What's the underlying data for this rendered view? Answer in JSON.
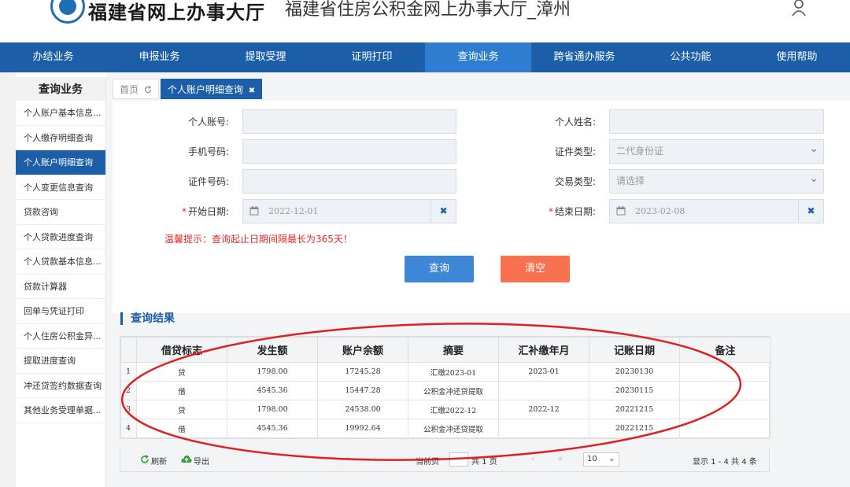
{
  "header": {
    "brand": "福建省网上办事大厅",
    "site_title": "福建省住房公积金网上办事大厅_漳州"
  },
  "nav": [
    "办结业务",
    "申报业务",
    "提取受理",
    "证明打印",
    "查询业务",
    "跨省通办服务",
    "公共功能",
    "使用帮助"
  ],
  "nav_active": "查询业务",
  "sidebar": {
    "title": "查询业务",
    "items": [
      "个人账户基本信息...",
      "个人缴存明细查询",
      "个人账户明细查询",
      "个人变更信息查询",
      "贷款咨询",
      "个人贷款进度查询",
      "个人贷款基本信息...",
      "贷款计算器",
      "回单与凭证打印",
      "个人住房公积金异...",
      "提取进度查询",
      "冲还贷签约数据查询",
      "其他业务受理单据..."
    ],
    "active": "个人账户明细查询"
  },
  "tabs": {
    "home": "首页",
    "active": "个人账户明细查询"
  },
  "form": {
    "account_label": "个人账号:",
    "name_label": "个人姓名:",
    "phone_label": "手机号码:",
    "id_type_label": "证件类型:",
    "id_type_value": "二代身份证",
    "id_no_label": "证件号码:",
    "trade_type_label": "交易类型:",
    "trade_type_placeholder": "请选择",
    "start_label": "开始日期:",
    "start_value": "2022-12-01",
    "end_label": "结束日期:",
    "end_value": "2023-02-08",
    "required_mark": "*",
    "clear_x": "✖",
    "tip": "温馨提示：查询起止日期间隔最长为365天！",
    "query_btn": "查询",
    "clear_btn": "清空"
  },
  "result": {
    "title": "查询结果",
    "columns": [
      "借贷标志",
      "发生额",
      "账户余额",
      "摘要",
      "汇补缴年月",
      "记账日期",
      "备注"
    ],
    "rows": [
      {
        "idx": "1",
        "flag": "贷",
        "amount": "1798.00",
        "balance": "17245.28",
        "summary": "汇缴2023-01",
        "ym": "2023-01",
        "date": "20230130",
        "remark": ""
      },
      {
        "idx": "2",
        "flag": "借",
        "amount": "4545.36",
        "balance": "15447.28",
        "summary": "公积金冲还贷提取",
        "ym": "",
        "date": "20230115",
        "remark": ""
      },
      {
        "idx": "3",
        "flag": "贷",
        "amount": "1798.00",
        "balance": "24538.00",
        "summary": "汇缴2022-12",
        "ym": "2022-12",
        "date": "20221215",
        "remark": ""
      },
      {
        "idx": "4",
        "flag": "借",
        "amount": "4545.36",
        "balance": "19992.64",
        "summary": "公积金冲还贷提取",
        "ym": "",
        "date": "20221215",
        "remark": ""
      }
    ]
  },
  "pager": {
    "refresh": "刷新",
    "export": "导出",
    "current_page": "当前页",
    "total_pages": "共 1 页",
    "page_size": "10",
    "summary": "显示 1 - 4  共 4 条"
  },
  "colors": {
    "nav": "#1c5fa8",
    "nav_active": "#2e7dd1",
    "query_btn": "#3e87d6",
    "clear_btn": "#f7714e",
    "tip": "#e02b2b",
    "annotation": "#e02020"
  },
  "icons": [
    "user-icon",
    "refresh-icon",
    "calendar-icon",
    "close-icon",
    "export-icon",
    "chevron-down-icon"
  ]
}
